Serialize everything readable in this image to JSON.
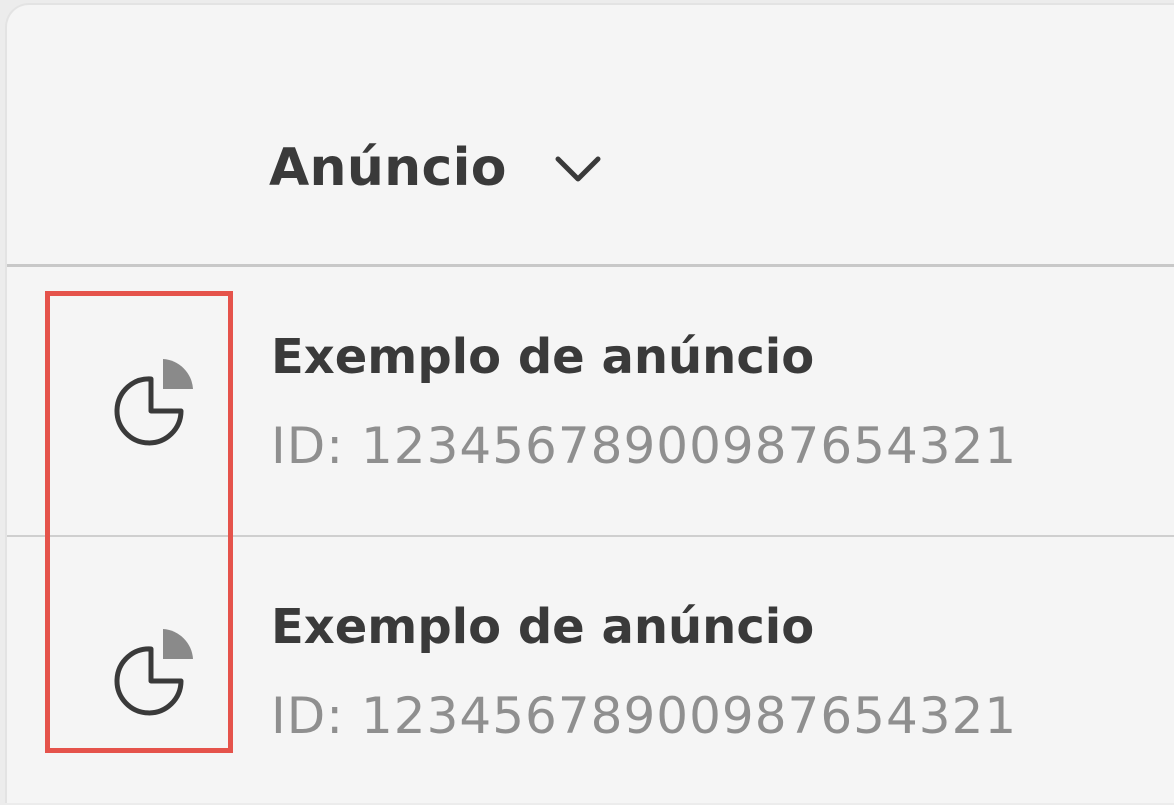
{
  "header": {
    "title": "Anúncio",
    "dropdown_icon": "chevron-down-icon"
  },
  "rows": [
    {
      "icon": "pie-chart-icon",
      "title": "Exemplo de anúncio",
      "id_text": "ID: 12345678900987654321"
    },
    {
      "icon": "pie-chart-icon",
      "title": "Exemplo de anúncio",
      "id_text": "ID: 12345678900987654321"
    }
  ],
  "colors": {
    "highlight": "#e5534b",
    "text_primary": "#3a3a3a",
    "text_secondary": "#8f8f8f",
    "icon_accent": "#8a8a8a"
  }
}
